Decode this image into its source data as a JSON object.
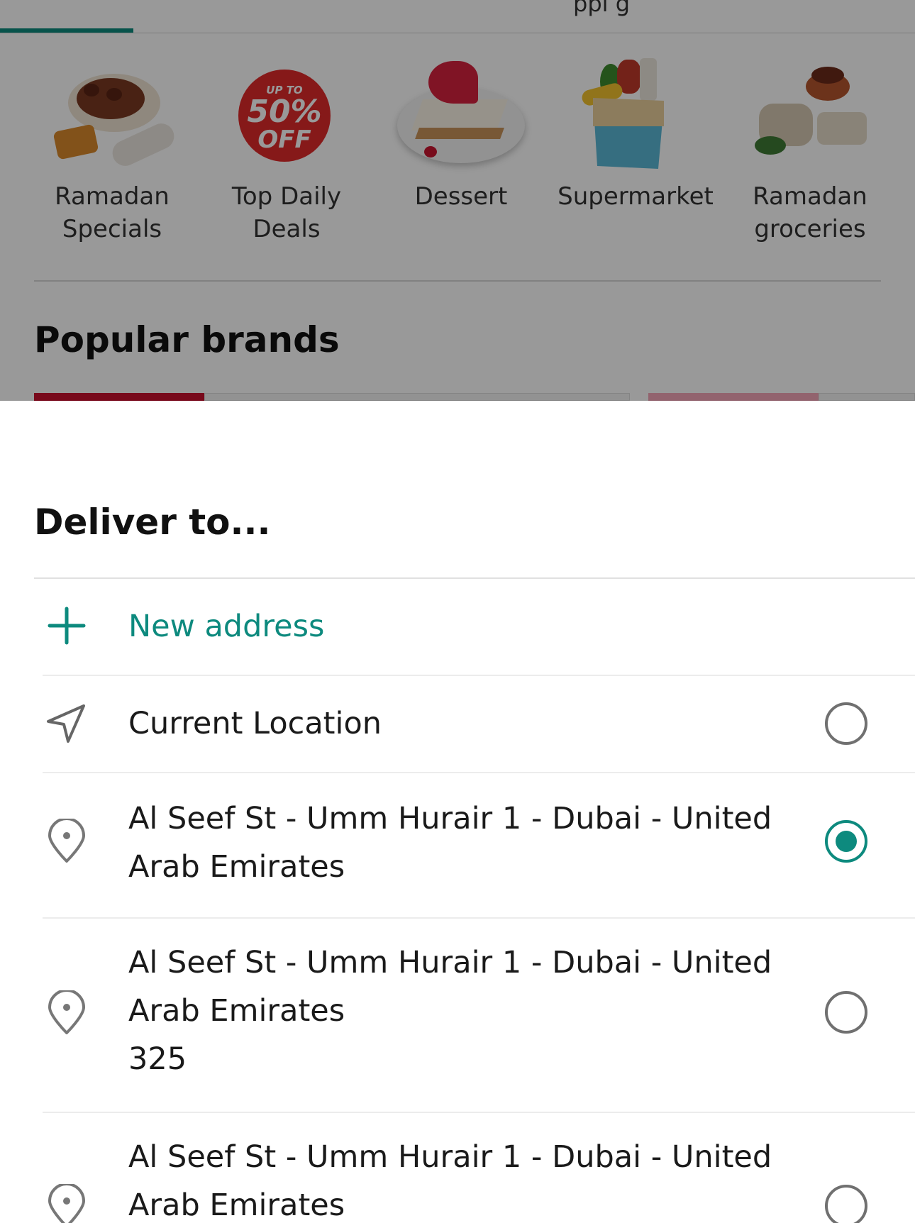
{
  "background": {
    "tab_partial_label": "ppi g",
    "categories": [
      {
        "label_line1": "Ramadan",
        "label_line2": "Specials",
        "icon": "ramadan-specials-food-icon"
      },
      {
        "label_line1": "Top Daily",
        "label_line2": "Deals",
        "icon": "discount-badge-icon"
      },
      {
        "label_line1": "Dessert",
        "label_line2": "",
        "icon": "cheesecake-icon"
      },
      {
        "label_line1": "Supermarket",
        "label_line2": "",
        "icon": "grocery-bag-icon"
      },
      {
        "label_line1": "Ramadan",
        "label_line2": "groceries",
        "icon": "dates-bread-icon"
      }
    ],
    "deal_badge": {
      "top": "UP TO",
      "pct": "50%",
      "off": "OFF"
    },
    "popular_brands_title": "Popular brands"
  },
  "sheet": {
    "title": "Deliver to...",
    "new_address_label": "New address",
    "current_location_label": "Current Location",
    "addresses": [
      {
        "line1": "Al Seef St - Umm Hurair 1 - Dubai - United",
        "line2": "Arab Emirates",
        "line3": "",
        "selected": true
      },
      {
        "line1": "Al Seef St - Umm Hurair 1 - Dubai - United",
        "line2": "Arab Emirates",
        "line3": "325",
        "selected": false
      },
      {
        "line1": "Al Seef St - Umm Hurair 1 - Dubai - United",
        "line2": "Arab Emirates",
        "line3": "",
        "selected": false
      }
    ]
  },
  "colors": {
    "accent": "#0d8a7e",
    "radio_idle": "#707070",
    "scrim": "rgba(0,0,0,0.40)"
  }
}
